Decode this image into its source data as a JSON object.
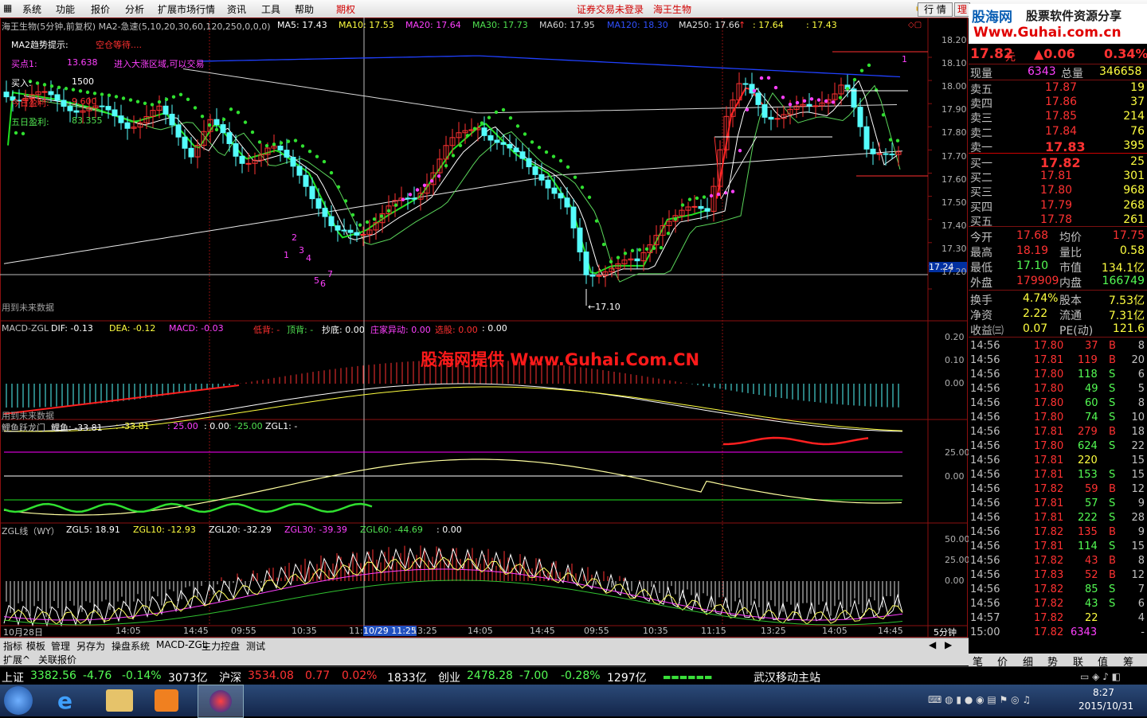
{
  "menu": {
    "items": [
      "系统",
      "功能",
      "报价",
      "分析",
      "扩展市场行情",
      "资讯",
      "工具",
      "帮助"
    ],
    "futures": "期权",
    "login_status": "证券交易未登录",
    "stock_name": "海王生物",
    "btn_quote": "行 情",
    "btn_trade": "理"
  },
  "logo": {
    "brand": "股海网",
    "slogan": "股票软件资源分享",
    "url": "Www.Guhai.com.cn"
  },
  "chart": {
    "header": "海王生物(5分钟,前复权) MA2-急速(5,10,20,30,60,120,250,0,0,0)",
    "ma5": "MA5: 17.43",
    "ma10": "MA10: 17.53",
    "ma20": "MA20: 17.64",
    "ma30": "MA30: 17.73",
    "ma60": "MA60: 17.95",
    "ma120": "MA120: 18.30",
    "ma250": "MA250: 17.66",
    "extra1": ": 17.64",
    "extra2": ": 17.43",
    "tips_title": "MA2趋势提示:",
    "tips_value": "空仓等待....",
    "buy_line_label": "买点1:",
    "buy_line_value": "13.638",
    "buy_line_note": "进入大涨区域,可以交易",
    "buy_label": "买入:",
    "buy_value": "1500",
    "today_label": "今日盈利:",
    "today_value": "9.600",
    "five_label": "五日盈利:",
    "five_value": "83.355",
    "future_note": "用到未来数据",
    "future_note2": "用到未来数据",
    "low_price": "17.10",
    "cursor_price": "17.24",
    "marker_1": "1",
    "wave_labels": [
      "1",
      "2",
      "3",
      "4",
      "5",
      "6",
      "7"
    ]
  },
  "price_axis": [
    "18.20",
    "18.10",
    "18.00",
    "17.90",
    "17.80",
    "17.70",
    "17.60",
    "17.50",
    "17.40",
    "17.30",
    "17.20"
  ],
  "macd": {
    "title": "MACD-ZGL",
    "dif": "DIF: -0.13",
    "dea": "DEA: -0.12",
    "macd": "MACD: -0.03",
    "low_div": "低背: -",
    "top_div": "顶背: -",
    "bottom": "抄底: 0.00",
    "zhuang": "庄家异动: 0.00",
    "select": "选股: 0.00",
    "tail": ": 0.00",
    "axis": [
      "0.20",
      "0.10",
      "0.00"
    ]
  },
  "watermark": "股海网提供 Www.Guhai.Com.CN",
  "carp": {
    "title": "鲤鱼跃龙门",
    "v1": "鲤鱼: -33.81",
    "v2": ": -33.81",
    "v3": ": 25.00",
    "v4": ": 0.00",
    "v5": ": -25.00",
    "v6": "ZGL1: -",
    "axis": [
      "25.00",
      "0.00"
    ]
  },
  "zgl": {
    "title": "ZGL线（WY）",
    "zgl5": "ZGL5: 18.91",
    "zgl10": "ZGL10: -12.93",
    "zgl20": "ZGL20: -32.29",
    "zgl30": "ZGL30: -39.39",
    "zgl60": "ZGL60: -44.69",
    "tail": ": 0.00",
    "axis": [
      "50.00",
      "25.00",
      "0.00"
    ]
  },
  "time_axis": [
    "10月28日",
    "14:05",
    "14:45",
    "09:55",
    "10:35",
    "11:15",
    "10/29 11:25",
    "13:25",
    "14:05",
    "14:45",
    "09:55",
    "10:35",
    "11:15",
    "13:25",
    "14:05",
    "14:45"
  ],
  "period": "5分钟",
  "tabs": [
    "指标",
    "模板",
    "管理",
    "另存为",
    "操盘系统",
    "MACD-ZGL",
    "主力控盘",
    "测试"
  ],
  "tabs2": [
    "扩展^",
    "关联报价"
  ],
  "quote": {
    "price": "17.82",
    "unit": "元",
    "change": "▲0.06",
    "pct": "0.34%",
    "now_vol_label": "现量",
    "now_vol": "6343",
    "total_vol_label": "总量",
    "total_vol": "346658",
    "asks": [
      {
        "label": "卖五",
        "price": "17.87",
        "vol": "19"
      },
      {
        "label": "卖四",
        "price": "17.86",
        "vol": "37"
      },
      {
        "label": "卖三",
        "price": "17.85",
        "vol": "214"
      },
      {
        "label": "卖二",
        "price": "17.84",
        "vol": "76"
      },
      {
        "label": "卖一",
        "price": "17.83",
        "vol": "395"
      }
    ],
    "bids": [
      {
        "label": "买一",
        "price": "17.82",
        "vol": "25"
      },
      {
        "label": "买二",
        "price": "17.81",
        "vol": "301"
      },
      {
        "label": "买三",
        "price": "17.80",
        "vol": "968"
      },
      {
        "label": "买四",
        "price": "17.79",
        "vol": "268"
      },
      {
        "label": "买五",
        "price": "17.78",
        "vol": "261"
      }
    ],
    "stats": [
      {
        "l1": "今开",
        "v1": "17.68",
        "l2": "均价",
        "v2": "17.75"
      },
      {
        "l1": "最高",
        "v1": "18.19",
        "l2": "量比",
        "v2": "0.58"
      },
      {
        "l1": "最低",
        "v1": "17.10",
        "l2": "市值",
        "v2": "134.1亿"
      },
      {
        "l1": "外盘",
        "v1": "179909",
        "l2": "内盘",
        "v2": "166749"
      }
    ],
    "stats2": [
      {
        "l1": "换手",
        "v1": "4.74%",
        "l2": "股本",
        "v2": "7.53亿"
      },
      {
        "l1": "净资",
        "v1": "2.22",
        "l2": "流通",
        "v2": "7.31亿"
      },
      {
        "l1": "收益㈢",
        "v1": "0.07",
        "l2": "PE(动)",
        "v2": "121.6"
      }
    ]
  },
  "ticks": [
    {
      "t": "14:56",
      "p": "17.80",
      "v": "37",
      "s": "B",
      "n": "8"
    },
    {
      "t": "14:56",
      "p": "17.81",
      "v": "119",
      "s": "B",
      "n": "20"
    },
    {
      "t": "14:56",
      "p": "17.80",
      "v": "118",
      "s": "S",
      "n": "6"
    },
    {
      "t": "14:56",
      "p": "17.80",
      "v": "49",
      "s": "S",
      "n": "5"
    },
    {
      "t": "14:56",
      "p": "17.80",
      "v": "60",
      "s": "S",
      "n": "8"
    },
    {
      "t": "14:56",
      "p": "17.80",
      "v": "74",
      "s": "S",
      "n": "10"
    },
    {
      "t": "14:56",
      "p": "17.81",
      "v": "279",
      "s": "B",
      "n": "18"
    },
    {
      "t": "14:56",
      "p": "17.80",
      "v": "624",
      "s": "S",
      "n": "22"
    },
    {
      "t": "14:56",
      "p": "17.81",
      "v": "220",
      "s": "",
      "n": "15"
    },
    {
      "t": "14:56",
      "p": "17.81",
      "v": "153",
      "s": "S",
      "n": "15"
    },
    {
      "t": "14:56",
      "p": "17.82",
      "v": "59",
      "s": "B",
      "n": "12"
    },
    {
      "t": "14:56",
      "p": "17.81",
      "v": "57",
      "s": "S",
      "n": "9"
    },
    {
      "t": "14:56",
      "p": "17.81",
      "v": "222",
      "s": "S",
      "n": "28"
    },
    {
      "t": "14:56",
      "p": "17.82",
      "v": "135",
      "s": "B",
      "n": "9"
    },
    {
      "t": "14:56",
      "p": "17.81",
      "v": "114",
      "s": "S",
      "n": "15"
    },
    {
      "t": "14:56",
      "p": "17.82",
      "v": "43",
      "s": "B",
      "n": "8"
    },
    {
      "t": "14:56",
      "p": "17.83",
      "v": "52",
      "s": "B",
      "n": "12"
    },
    {
      "t": "14:56",
      "p": "17.82",
      "v": "85",
      "s": "S",
      "n": "7"
    },
    {
      "t": "14:56",
      "p": "17.82",
      "v": "43",
      "s": "S",
      "n": "6"
    },
    {
      "t": "14:57",
      "p": "17.82",
      "v": "22",
      "s": "",
      "n": "4"
    },
    {
      "t": "15:00",
      "p": "17.82",
      "v": "6343",
      "s": "",
      "n": "-"
    }
  ],
  "right_tabs": [
    "笔",
    "价",
    "细",
    "势",
    "联",
    "值",
    "筹"
  ],
  "index_bar": {
    "sh_label": "上证",
    "sh_val": "3382.56",
    "sh_chg": "-4.76",
    "sh_pct": "-0.14%",
    "sh_amt": "3073亿",
    "hs_label": "沪深",
    "hs_val": "3534.08",
    "hs_chg": "0.77",
    "hs_pct": "0.02%",
    "hs_amt": "1833亿",
    "cy_label": "创业",
    "cy_val": "2478.28",
    "cy_chg": "-7.00",
    "cy_pct": "-0.28%",
    "cy_amt": "1297亿",
    "server": "武汉移动主站"
  },
  "clock": {
    "time": "8:27",
    "date": "2015/10/31"
  },
  "colors": {
    "up": "#ff3232",
    "down": "#54fcfc",
    "yellow": "#ffff00",
    "green": "#00e000",
    "magenta": "#ff00ff",
    "blue": "#2040ff"
  }
}
